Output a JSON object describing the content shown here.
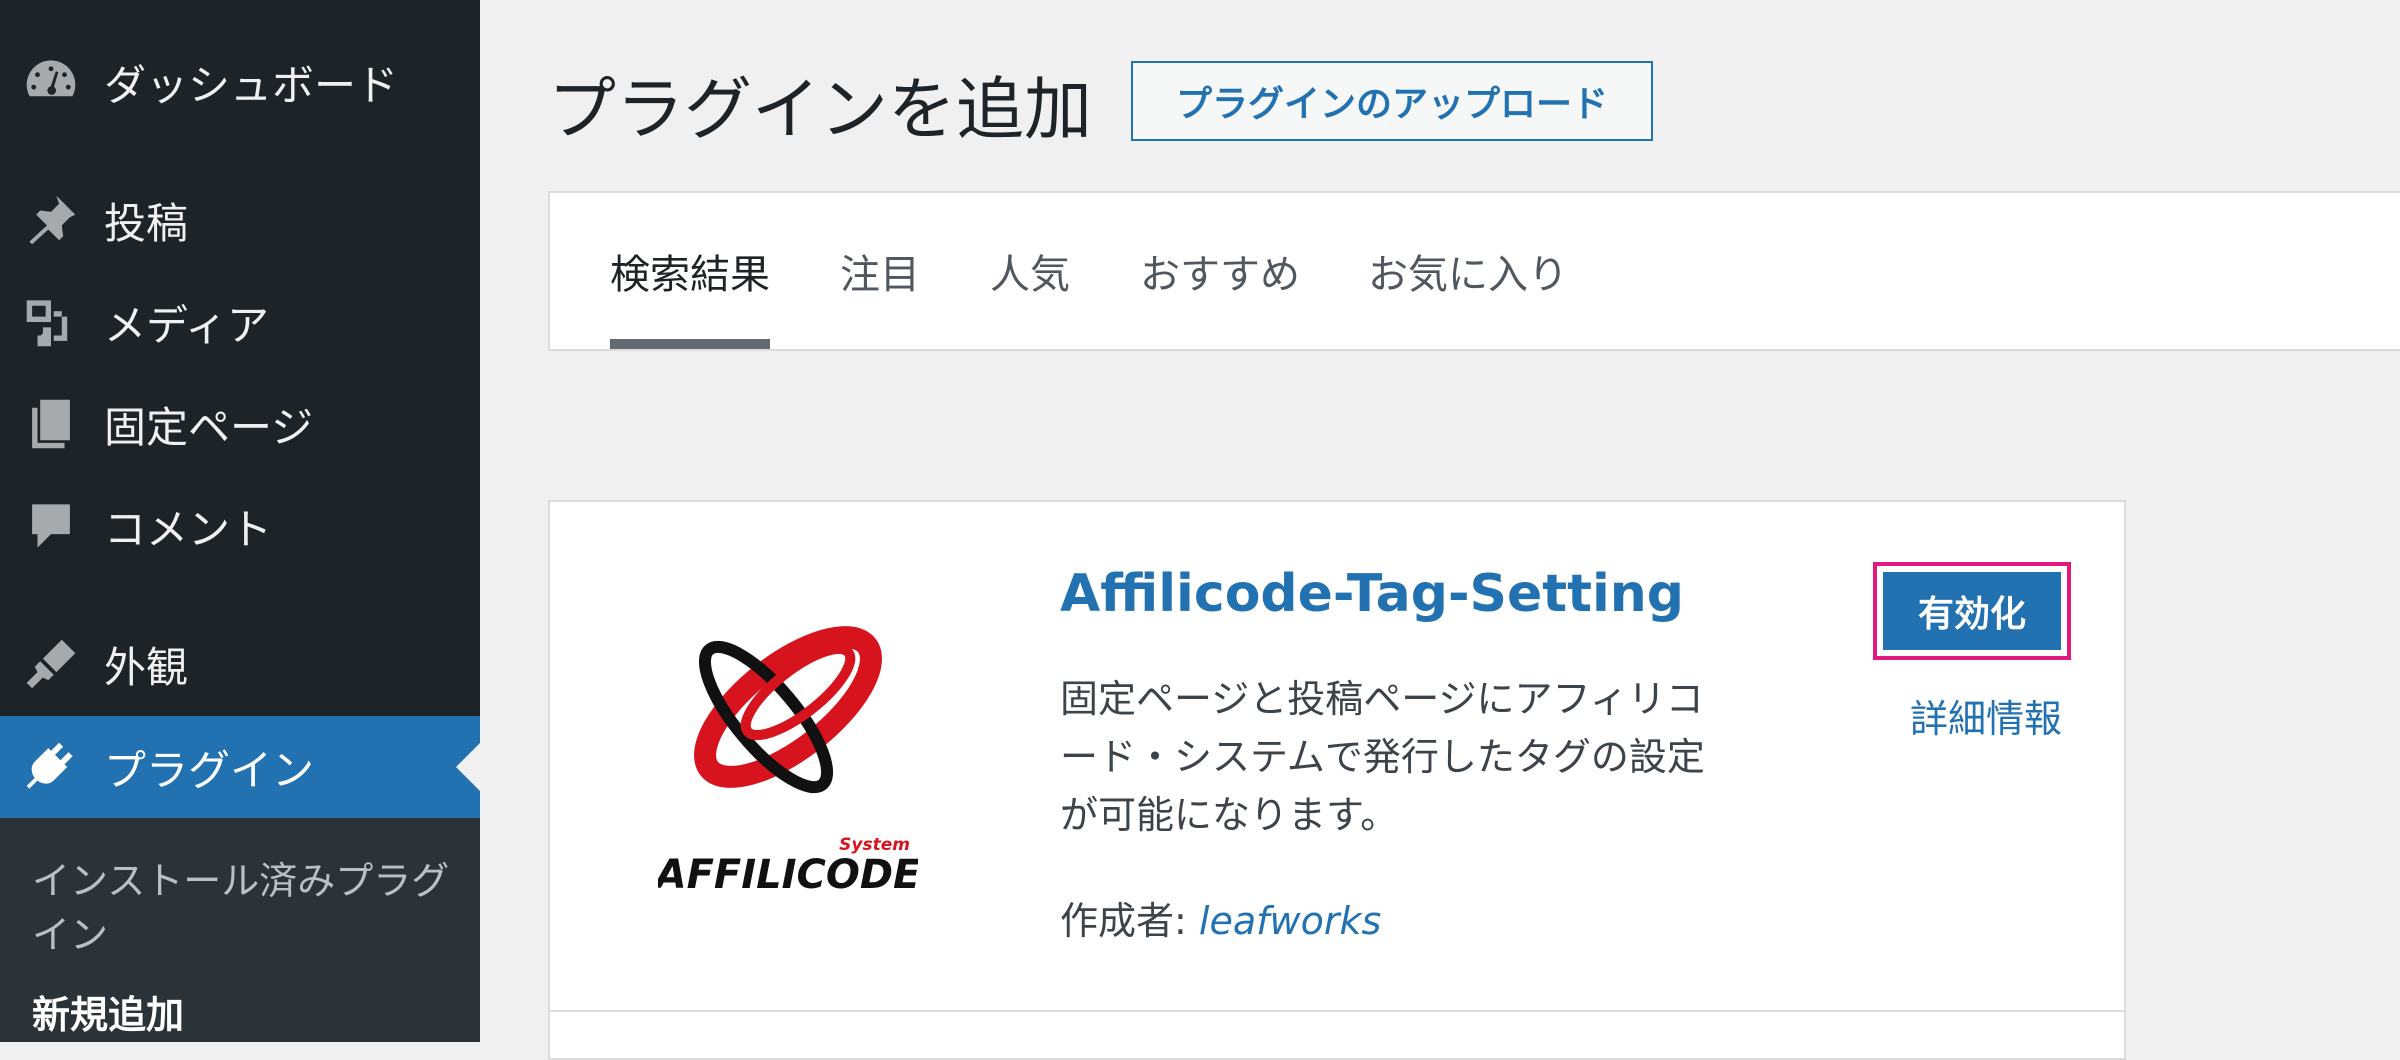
{
  "sidebar": {
    "items": [
      {
        "label": "ダッシュボード",
        "icon": "dashboard-icon"
      },
      {
        "label": "投稿",
        "icon": "pin-icon"
      },
      {
        "label": "メディア",
        "icon": "media-icon"
      },
      {
        "label": "固定ページ",
        "icon": "pages-icon"
      },
      {
        "label": "コメント",
        "icon": "comment-icon"
      },
      {
        "label": "外観",
        "icon": "brush-icon"
      },
      {
        "label": "プラグイン",
        "icon": "plugin-icon"
      }
    ],
    "submenu": [
      {
        "label": "インストール済みプラグイン"
      },
      {
        "label": "新規追加"
      }
    ]
  },
  "header": {
    "title": "プラグインを追加",
    "upload_label": "プラグインのアップロード"
  },
  "tabs": [
    {
      "label": "検索結果"
    },
    {
      "label": "注目"
    },
    {
      "label": "人気"
    },
    {
      "label": "おすすめ"
    },
    {
      "label": "お気に入り"
    }
  ],
  "plugin": {
    "name": "Affilicode-Tag-Setting",
    "description": "固定ページと投稿ページにアフィリコード・システムで発行したタグの設定が可能になります。",
    "author_label": "作成者:",
    "author": "leafworks",
    "activate_label": "有効化",
    "details_label": "詳細情報",
    "logo_text": "AFFILICODE",
    "logo_subtext": "System"
  },
  "colors": {
    "accent": "#2271b1",
    "sidebar_bg": "#1d2327",
    "highlight": "#e3197d",
    "logo_red": "#d7141d"
  }
}
